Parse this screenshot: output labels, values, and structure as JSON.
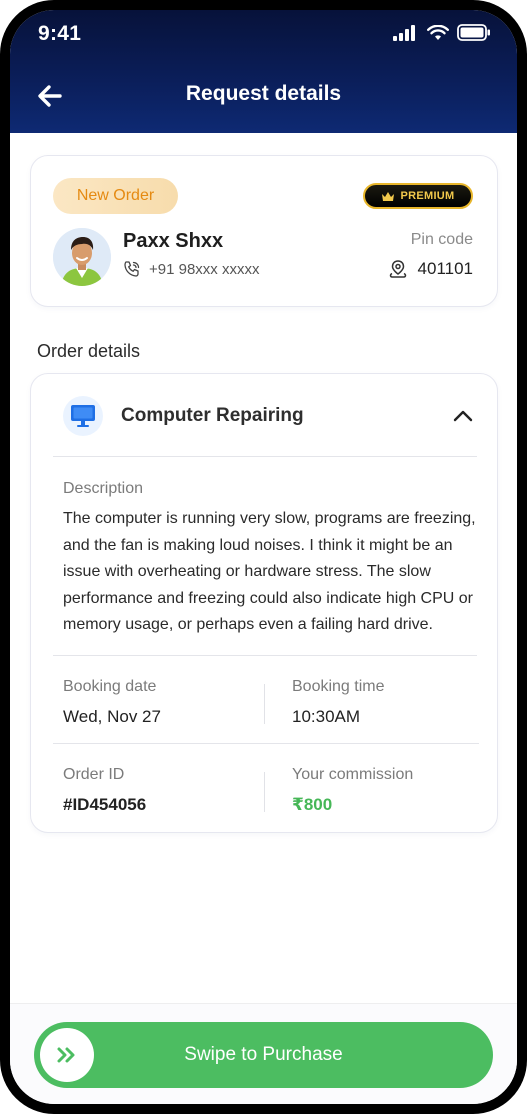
{
  "status_bar": {
    "time": "9:41"
  },
  "header": {
    "title": "Request details",
    "back_icon": "arrow-left-icon"
  },
  "customer": {
    "status_badge": "New Order",
    "premium_badge": "PREMIUM",
    "name": "Paxx Shxx",
    "phone": "+91 98xxx xxxxx",
    "pin_label": "Pin code",
    "pin_code": "401101"
  },
  "order_section": {
    "title": "Order details"
  },
  "order": {
    "service_name": "Computer Repairing",
    "description_label": "Description",
    "description": "The computer is running very slow, programs are freezing, and the fan is making loud noises. I think it might be an issue with overheating or hardware stress. The slow performance and freezing could also indicate high CPU or memory usage, or perhaps even a failing hard drive.",
    "booking_date_label": "Booking date",
    "booking_date": "Wed, Nov 27",
    "booking_time_label": "Booking time",
    "booking_time": "10:30AM",
    "order_id_label": "Order ID",
    "order_id": "#ID454056",
    "commission_label": "Your commission",
    "commission": "₹800"
  },
  "action": {
    "swipe_label": "Swipe to Purchase"
  },
  "colors": {
    "header_dark": "#07123a",
    "accent_green": "#4cbd61",
    "badge_orange": "#e58a12",
    "premium_gold": "#e8b62b",
    "service_blue": "#1f6fe5"
  }
}
